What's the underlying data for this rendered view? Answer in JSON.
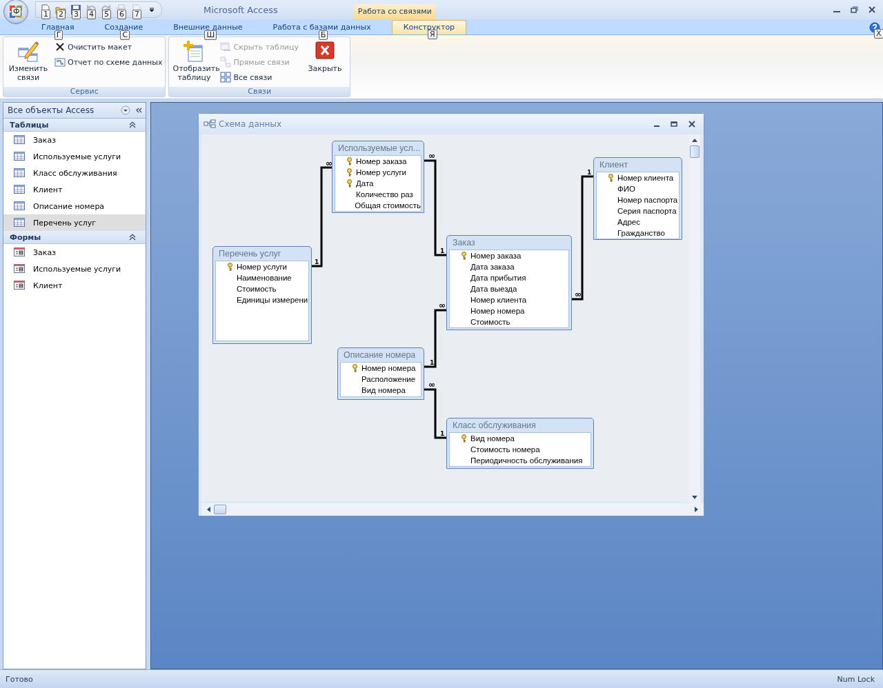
{
  "app": {
    "title": "Microsoft Access",
    "office_keytip": "Ф"
  },
  "quick_access": [
    {
      "keytip": "1",
      "disabled": false
    },
    {
      "keytip": "2",
      "disabled": false
    },
    {
      "keytip": "3",
      "disabled": false
    },
    {
      "keytip": "4",
      "disabled": true
    },
    {
      "keytip": "5",
      "disabled": true
    },
    {
      "keytip": "6",
      "disabled": true
    },
    {
      "keytip": "7",
      "disabled": true
    }
  ],
  "contextual_tab_group": "Работа со связями",
  "tabs": [
    {
      "label": "Главная",
      "keytip": "Г",
      "selected": false
    },
    {
      "label": "Создание",
      "keytip": "С",
      "selected": false
    },
    {
      "label": "Внешние данные",
      "keytip": "Ш",
      "selected": false
    },
    {
      "label": "Работа с базами данных",
      "keytip": "Б",
      "selected": false
    },
    {
      "label": "Конструктор",
      "keytip": "Я",
      "selected": true
    }
  ],
  "help_keytip": "X",
  "ribbon_groups": [
    {
      "label": "Сервис",
      "buttons": [
        {
          "kind": "large",
          "label": "Изменить связи",
          "disabled": false
        },
        {
          "kind": "stack",
          "items": [
            {
              "label": "Очистить макет",
              "disabled": false
            },
            {
              "label": "Отчет по схеме данных",
              "disabled": false
            }
          ]
        }
      ]
    },
    {
      "label": "Связи",
      "buttons": [
        {
          "kind": "large",
          "label": "Отобразить таблицу",
          "disabled": false
        },
        {
          "kind": "stack",
          "items": [
            {
              "label": "Скрыть таблицу",
              "disabled": true
            },
            {
              "label": "Прямые связи",
              "disabled": true
            },
            {
              "label": "Все связи",
              "disabled": false
            }
          ]
        },
        {
          "kind": "large",
          "label": "Закрыть",
          "disabled": false
        }
      ]
    }
  ],
  "nav_pane": {
    "title": "Все объекты Access",
    "groups": [
      {
        "label": "Таблицы",
        "expanded": true,
        "items": [
          {
            "kind": "table",
            "label": "Заказ",
            "selected": false
          },
          {
            "kind": "table",
            "label": "Используемые услуги",
            "selected": false
          },
          {
            "kind": "table",
            "label": "Класс обслуживания",
            "selected": false
          },
          {
            "kind": "table",
            "label": "Клиент",
            "selected": false
          },
          {
            "kind": "table",
            "label": "Описание номера",
            "selected": false
          },
          {
            "kind": "table",
            "label": "Перечень услуг",
            "selected": true
          }
        ]
      },
      {
        "label": "Формы",
        "expanded": true,
        "items": [
          {
            "kind": "form",
            "label": "Заказ",
            "selected": false
          },
          {
            "kind": "form",
            "label": "Используемые услуги",
            "selected": false
          },
          {
            "kind": "form",
            "label": "Клиент",
            "selected": false
          }
        ]
      }
    ]
  },
  "diagram_window": {
    "title": "Схема данных",
    "tables": [
      {
        "title": "Используемые усл...",
        "fields": [
          {
            "name": "Номер заказа",
            "key": true
          },
          {
            "name": "Номер услуги",
            "key": true
          },
          {
            "name": "Дата",
            "key": true
          },
          {
            "name": "Количество раз",
            "key": false
          },
          {
            "name": "Общая стоимость",
            "key": false
          }
        ]
      },
      {
        "title": "Перечень услуг",
        "fields": [
          {
            "name": "Номер услуги",
            "key": true
          },
          {
            "name": "Наименование",
            "key": false
          },
          {
            "name": "Стоимость",
            "key": false
          },
          {
            "name": "Единицы измерени",
            "key": false
          }
        ]
      },
      {
        "title": "Заказ",
        "fields": [
          {
            "name": "Номер заказа",
            "key": true
          },
          {
            "name": "Дата заказа",
            "key": false
          },
          {
            "name": "Дата прибытия",
            "key": false
          },
          {
            "name": "Дата выезда",
            "key": false
          },
          {
            "name": "Номер клиента",
            "key": false
          },
          {
            "name": "Номер номера",
            "key": false
          },
          {
            "name": "Стоимость",
            "key": false
          }
        ]
      },
      {
        "title": "Клиент",
        "fields": [
          {
            "name": "Номер клиента",
            "key": true
          },
          {
            "name": "ФИО",
            "key": false
          },
          {
            "name": "Номер паспорта",
            "key": false
          },
          {
            "name": "Серия паспорта",
            "key": false
          },
          {
            "name": "Адрес",
            "key": false
          },
          {
            "name": "Гражданство",
            "key": false
          }
        ]
      },
      {
        "title": "Описание номера",
        "fields": [
          {
            "name": "Номер номера",
            "key": true
          },
          {
            "name": "Расположение",
            "key": false
          },
          {
            "name": "Вид номера",
            "key": false
          }
        ]
      },
      {
        "title": "Класс обслуживания",
        "fields": [
          {
            "name": "Вид номера",
            "key": true
          },
          {
            "name": "Стоимость номера",
            "key": false
          },
          {
            "name": "Периодичность обслуживания",
            "key": false
          }
        ]
      }
    ],
    "relationships": [
      {
        "one_label": "1",
        "many_label": "∞"
      },
      {
        "one_label": "1",
        "many_label": "∞"
      },
      {
        "one_label": "1",
        "many_label": "∞"
      },
      {
        "one_label": "1",
        "many_label": "∞"
      },
      {
        "one_label": "1",
        "many_label": "∞"
      }
    ]
  },
  "status_bar": {
    "left": "Готово",
    "right": "Num Lock"
  }
}
